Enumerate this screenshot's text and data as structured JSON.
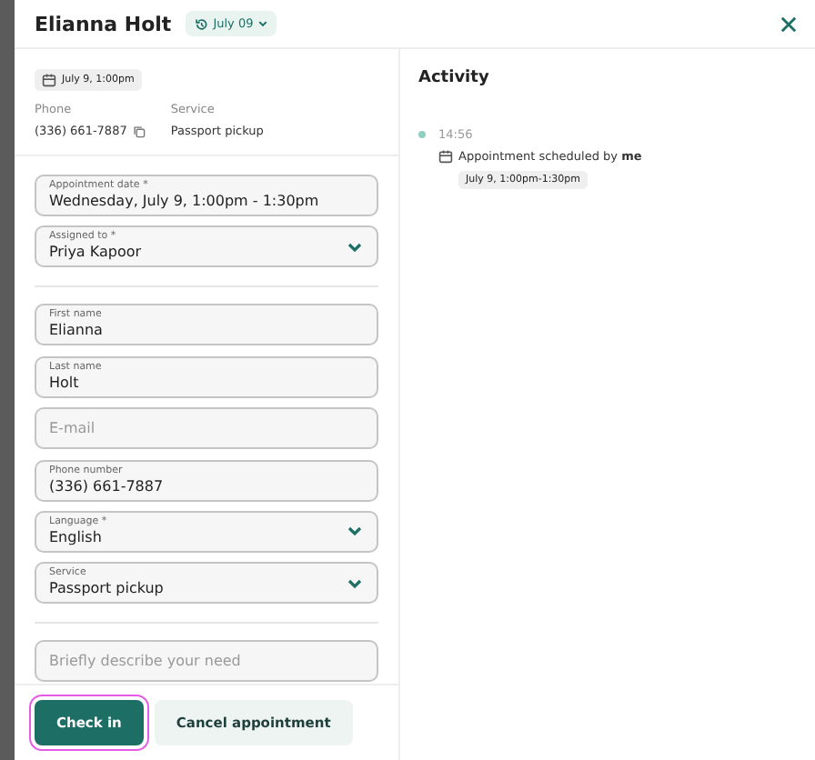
{
  "header": {
    "name": "Elianna Holt",
    "date_chip": "July 09"
  },
  "summary": {
    "date_chip": "July 9, 1:00pm",
    "details": [
      {
        "label": "Phone",
        "value": "(336) 661-7887",
        "copy": true
      },
      {
        "label": "Service",
        "value": "Passport pickup",
        "copy": false
      }
    ]
  },
  "field_groups": [
    [
      {
        "kind": "text",
        "label": "Appointment date *",
        "value": "Wednesday, July 9, 1:00pm - 1:30pm"
      },
      {
        "kind": "select",
        "label": "Assigned to *",
        "value": "Priya Kapoor"
      }
    ],
    [
      {
        "kind": "text",
        "label": "First name",
        "value": "Elianna"
      },
      {
        "kind": "text",
        "label": "Last name",
        "value": "Holt"
      },
      {
        "kind": "text",
        "placeholder": "E-mail"
      },
      {
        "kind": "text",
        "label": "Phone number",
        "value": "(336) 661-7887"
      },
      {
        "kind": "select",
        "label": "Language *",
        "value": "English"
      },
      {
        "kind": "select",
        "label": "Service",
        "value": "Passport pickup"
      }
    ],
    [
      {
        "kind": "text",
        "placeholder": "Briefly describe your need"
      }
    ]
  ],
  "buttons": [
    {
      "label": "Check in",
      "kind": "primary",
      "focused": true
    },
    {
      "label": "Cancel appointment",
      "kind": "secondary",
      "focused": false
    }
  ],
  "activity": {
    "title": "Activity",
    "entries": [
      {
        "time": "14:56",
        "text": "Appointment scheduled by **me**",
        "chip": "July 9, 1:00pm-1:30pm"
      }
    ]
  }
}
